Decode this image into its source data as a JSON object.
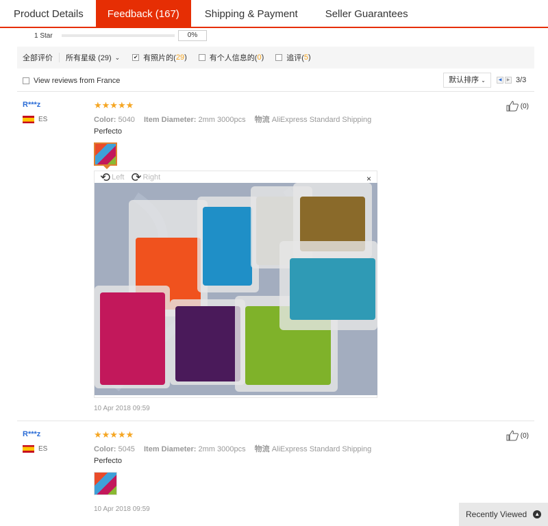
{
  "tabs": [
    {
      "label": "Product Details"
    },
    {
      "label": "Feedback (167)"
    },
    {
      "label": "Shipping & Payment"
    },
    {
      "label": "Seller Guarantees"
    }
  ],
  "rating_row": {
    "label": "1 Star",
    "percent_text": "0%",
    "fill_fraction": 0.0
  },
  "filters": {
    "all": "全部评价",
    "star_select": "所有星级 (29)",
    "with_photos": {
      "label": "有照片的(",
      "count": "29",
      "close": ")",
      "checked": true
    },
    "with_info": {
      "label": "有个人信息的(",
      "count": "0",
      "close": ")",
      "checked": false
    },
    "additional": {
      "label": "追评(",
      "count": "5",
      "close": ")",
      "checked": false
    }
  },
  "view_reviews": {
    "label": "View reviews from France",
    "checked": false
  },
  "sort": {
    "label": "默认排序"
  },
  "pager": {
    "text": "3/3"
  },
  "reviews": [
    {
      "user": "R***z",
      "country": "ES",
      "stars": "★★★★★",
      "color_label": "Color:",
      "color_value": "5040",
      "diameter_label": "Item Diameter:",
      "diameter_value": "2mm 3000pcs",
      "shipping_label": "物流",
      "shipping_value": "AliExpress Standard Shipping",
      "text": "Perfecto",
      "likes": "(0)",
      "date": "10 Apr 2018 09:59",
      "viewer": {
        "left": "Left",
        "right": "Right",
        "close": "×"
      }
    },
    {
      "user": "R***z",
      "country": "ES",
      "stars": "★★★★★",
      "color_label": "Color:",
      "color_value": "5045",
      "diameter_label": "Item Diameter:",
      "diameter_value": "2mm 3000pcs",
      "shipping_label": "物流",
      "shipping_value": "AliExpress Standard Shipping",
      "text": "Perfecto",
      "likes": "(0)",
      "date": "10 Apr 2018 09:59"
    }
  ],
  "recently_viewed": {
    "label": "Recently Viewed"
  },
  "colors": {
    "accent": "#e62e04",
    "star": "#f5a623",
    "link": "#2a6cd6"
  }
}
